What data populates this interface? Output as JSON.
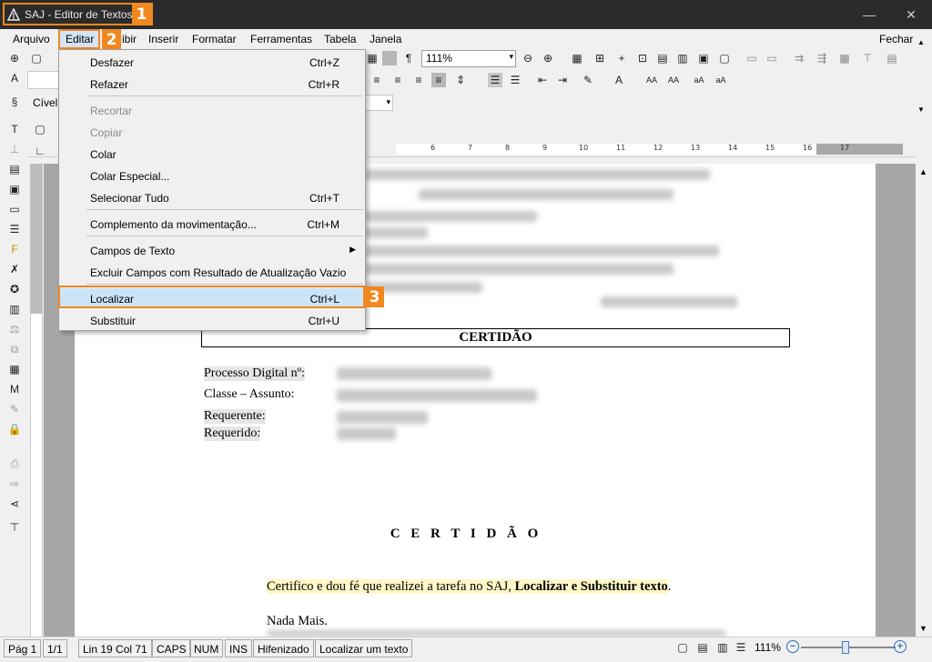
{
  "window": {
    "title": "SAJ - Editor de Textos",
    "minimize": "—",
    "maximize": "☐",
    "close": "✕"
  },
  "callouts": [
    "1",
    "2",
    "3"
  ],
  "menubar": {
    "items": [
      {
        "label": "Arquivo"
      },
      {
        "label": "Editar"
      },
      {
        "label": "Exibir",
        "partial": "ibir"
      },
      {
        "label": "Inserir"
      },
      {
        "label": "Formatar"
      },
      {
        "label": "Ferramentas"
      },
      {
        "label": "Tabela"
      },
      {
        "label": "Janela"
      }
    ],
    "fechar": "Fechar"
  },
  "toolbar": {
    "zoom": "111%",
    "civel": "Cível"
  },
  "ruler": {
    "numbers": [
      "6",
      "7",
      "8",
      "9",
      "10",
      "11",
      "12",
      "13",
      "14",
      "15",
      "16",
      "17"
    ]
  },
  "edit_menu": {
    "items": [
      {
        "label": "Desfazer",
        "shortcut": "Ctrl+Z",
        "enabled": true
      },
      {
        "label": "Refazer",
        "shortcut": "Ctrl+R",
        "enabled": true
      },
      {
        "label": "Recortar",
        "shortcut": "",
        "enabled": false
      },
      {
        "label": "Copiar",
        "shortcut": "",
        "enabled": false
      },
      {
        "label": "Colar",
        "shortcut": "",
        "enabled": true
      },
      {
        "label": "Colar Especial...",
        "shortcut": "",
        "enabled": true
      },
      {
        "label": "Selecionar Tudo",
        "shortcut": "Ctrl+T",
        "enabled": true
      },
      {
        "label": "Complemento da movimentação...",
        "shortcut": "Ctrl+M",
        "enabled": true
      },
      {
        "label": "Campos de Texto",
        "shortcut": "",
        "enabled": true,
        "submenu": true
      },
      {
        "label": "Excluir Campos com Resultado de Atualização Vazio",
        "shortcut": "",
        "enabled": true
      },
      {
        "label": "Localizar",
        "shortcut": "Ctrl+L",
        "enabled": true,
        "selected": true
      },
      {
        "label": "Substituir",
        "shortcut": "Ctrl+U",
        "enabled": true
      }
    ]
  },
  "document": {
    "header_box": "CERTIDÃO",
    "labels": {
      "processo": "Processo Digital nº:",
      "classe": "Classe – Assunto:",
      "requerente": "Requerente:",
      "requerido": "Requerido:"
    },
    "title_spaced": "C E R T I D Ã O",
    "para_text": "Certifico e dou fé que realizei a tarefa no SAJ, ",
    "para_bold": "Localizar e Substituir texto",
    "para_end": ".",
    "nada": "Nada Mais."
  },
  "statusbar": {
    "page": "Pág 1",
    "pages": "1/1",
    "line_col": "Lin 19  Col 71",
    "caps": "CAPS",
    "num": "NUM",
    "ins": "INS",
    "hifenizado": "Hifenizado",
    "action": "Localizar um texto",
    "zoom": "111%",
    "zoom_out": "−",
    "zoom_in": "+"
  },
  "colors": {
    "highlight": "#f0871f",
    "selection": "#cce4f7",
    "titlebar": "#2b2b2b"
  }
}
